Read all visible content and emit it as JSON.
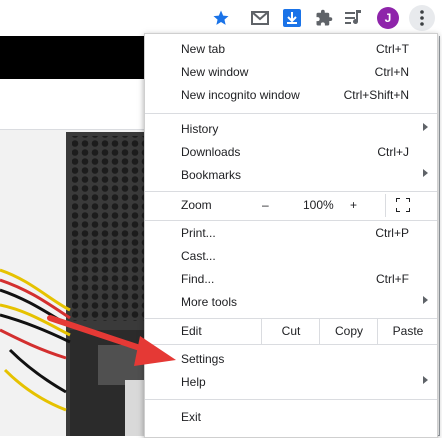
{
  "toolbar": {
    "icons": [
      "star-icon",
      "gmail-icon",
      "download-icon",
      "extensions-icon",
      "media-control-icon",
      "avatar",
      "more-menu-icon"
    ],
    "avatar_letter": "J",
    "star_color": "#1a73e8",
    "avatar_color": "#8e24aa"
  },
  "menu": {
    "new_tab": {
      "label": "New tab",
      "shortcut": "Ctrl+T"
    },
    "new_window": {
      "label": "New window",
      "shortcut": "Ctrl+N"
    },
    "new_incognito": {
      "label": "New incognito window",
      "shortcut": "Ctrl+Shift+N"
    },
    "history": {
      "label": "History"
    },
    "downloads": {
      "label": "Downloads",
      "shortcut": "Ctrl+J"
    },
    "bookmarks": {
      "label": "Bookmarks"
    },
    "zoom": {
      "label": "Zoom",
      "minus": "–",
      "value": "100%",
      "plus": "+"
    },
    "print": {
      "label": "Print...",
      "shortcut": "Ctrl+P"
    },
    "cast": {
      "label": "Cast..."
    },
    "find": {
      "label": "Find...",
      "shortcut": "Ctrl+F"
    },
    "more_tools": {
      "label": "More tools"
    },
    "edit": {
      "label": "Edit",
      "cut": "Cut",
      "copy": "Copy",
      "paste": "Paste"
    },
    "settings": {
      "label": "Settings"
    },
    "help": {
      "label": "Help"
    },
    "exit": {
      "label": "Exit"
    }
  },
  "annotation": {
    "arrow_color": "#e53935"
  }
}
